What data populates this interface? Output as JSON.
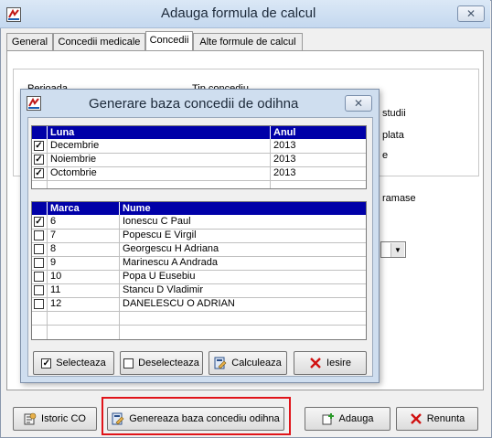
{
  "window": {
    "title": "Adauga formula de calcul",
    "close_label": "✕"
  },
  "tabs": [
    {
      "label": "General"
    },
    {
      "label": "Concedii medicale"
    },
    {
      "label": "Concedii"
    },
    {
      "label": "Alte formule de calcul"
    }
  ],
  "background_fragments": {
    "label_perioada": "Perioada",
    "label_tip": "Tip concediu",
    "opt_studii": "studii",
    "opt_plata": "plata",
    "opt_e": "e",
    "opt_ramase": "ramase"
  },
  "dialog": {
    "title": "Generare baza concedii de odihna",
    "close_label": "✕",
    "months_grid": {
      "headers": [
        "Luna",
        "Anul"
      ],
      "rows": [
        {
          "checked": true,
          "luna": "Decembrie",
          "anul": "2013"
        },
        {
          "checked": true,
          "luna": "Noiembrie",
          "anul": "2013"
        },
        {
          "checked": true,
          "luna": "Octombrie",
          "anul": "2013"
        }
      ]
    },
    "employees_grid": {
      "headers": [
        "Marca",
        "Nume"
      ],
      "rows": [
        {
          "checked": true,
          "marca": "6",
          "nume": "Ionescu C Paul"
        },
        {
          "checked": false,
          "marca": "7",
          "nume": "Popescu E Virgil"
        },
        {
          "checked": false,
          "marca": "8",
          "nume": "Georgescu H Adriana"
        },
        {
          "checked": false,
          "marca": "9",
          "nume": "Marinescu A Andrada"
        },
        {
          "checked": false,
          "marca": "10",
          "nume": "Popa U Eusebiu"
        },
        {
          "checked": false,
          "marca": "11",
          "nume": "Stancu D Vladimir"
        },
        {
          "checked": false,
          "marca": "12",
          "nume": "DANELESCU O ADRIAN"
        }
      ]
    },
    "buttons": {
      "select_label": "Selecteaza",
      "deselect_label": "Deselecteaza",
      "calc_label": "Calculeaza",
      "exit_label": "Iesire"
    }
  },
  "footer": {
    "istoric_label": "Istoric CO",
    "genereaza_label": "Genereaza baza concediu odihna",
    "adauga_label": "Adauga",
    "renunta_label": "Renunta"
  },
  "colors": {
    "grid_header": "#0000a8",
    "highlight": "#e0141a",
    "exit_x": "#d01010",
    "renunta_x": "#d01010",
    "add_plus": "#2a9a2a"
  }
}
